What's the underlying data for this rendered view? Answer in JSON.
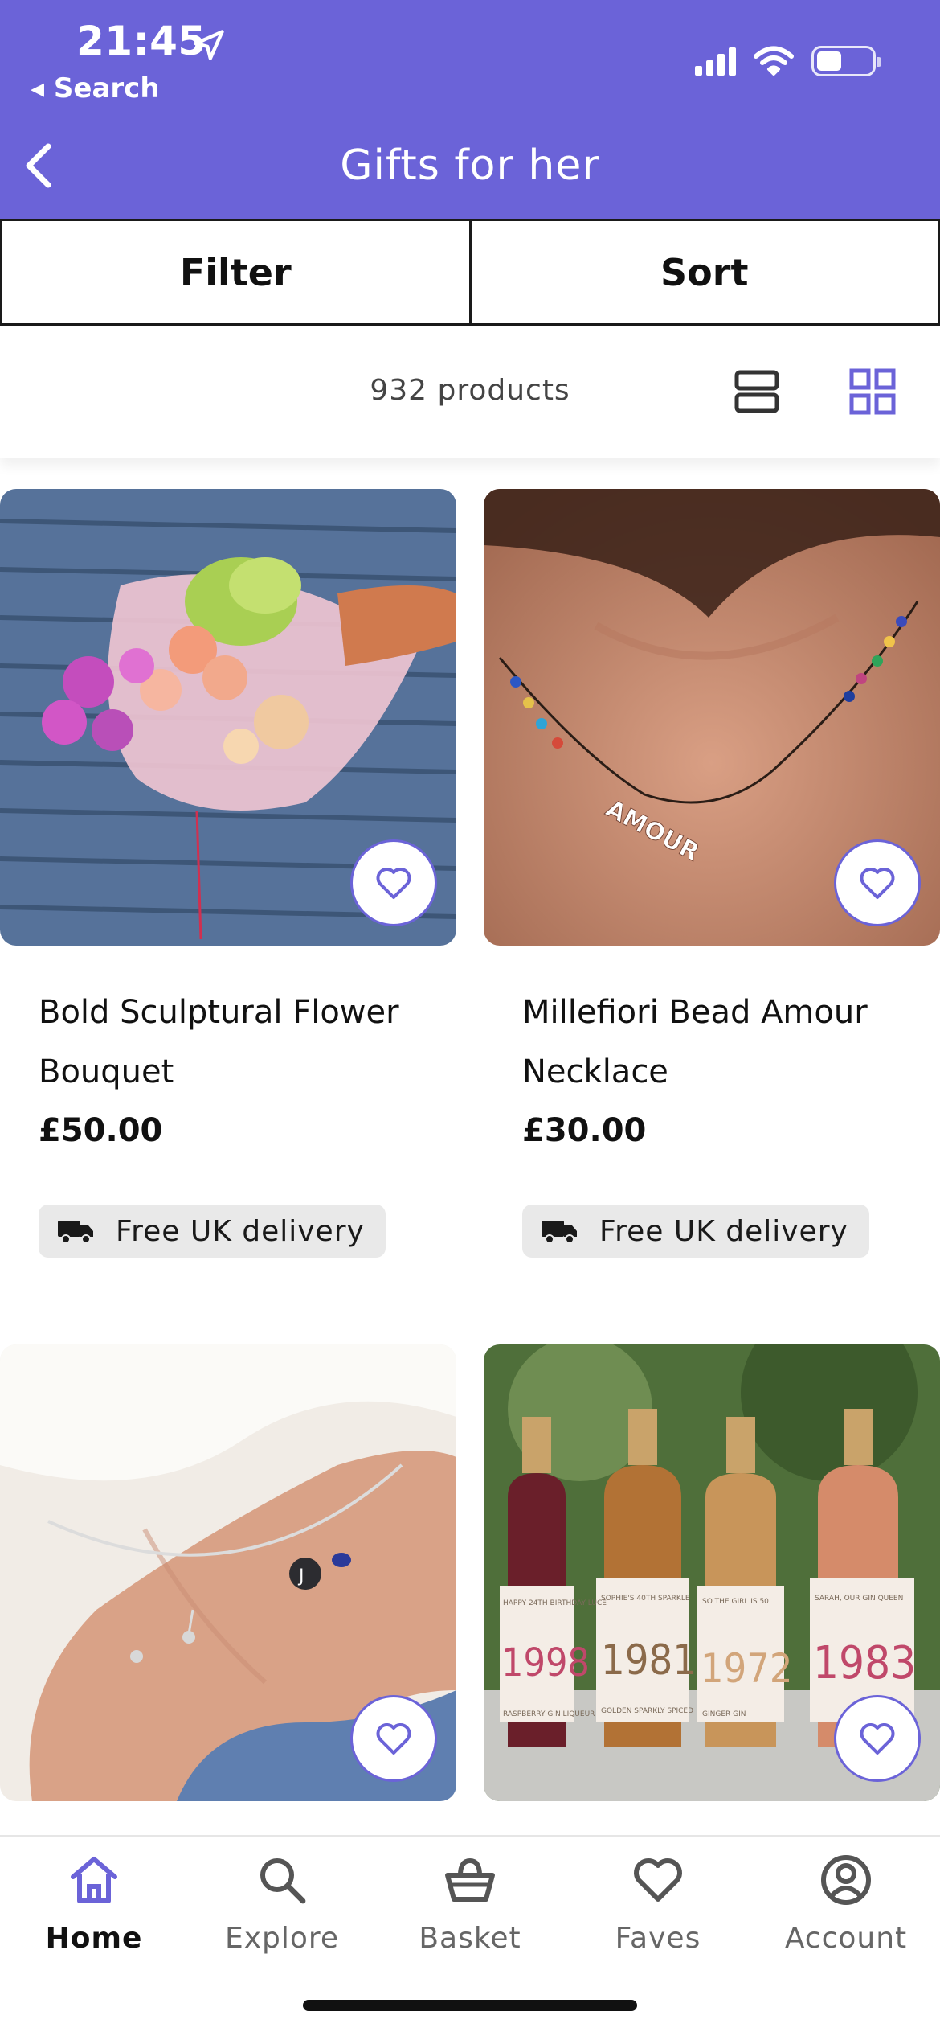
{
  "status_bar": {
    "time": "21:45",
    "back_app": "Search",
    "icons": [
      "location-arrow-icon",
      "cellular-signal-icon",
      "wifi-icon",
      "battery-icon"
    ]
  },
  "header": {
    "title": "Gifts for her",
    "back_icon": "chevron-left-icon",
    "background": "#6b63d8"
  },
  "controls": {
    "filter_label": "Filter",
    "sort_label": "Sort"
  },
  "results": {
    "count_text": "932 products",
    "view_options": [
      "list-view-icon",
      "grid-view-icon"
    ],
    "active_view": "grid"
  },
  "products": [
    {
      "name": "Bold Sculptural Flower Bouquet",
      "price": "£50.00",
      "badge": "Free UK delivery"
    },
    {
      "name": "Millefiori Bead Amour Necklace",
      "price": "£30.00",
      "badge": "Free UK delivery"
    },
    {
      "name": "",
      "price": "",
      "badge": ""
    },
    {
      "name": "",
      "price": "",
      "badge": ""
    }
  ],
  "necklace_text": "AMOUR",
  "bracelet_initial": "J",
  "gin_bottles": [
    {
      "year": "1998",
      "top": "HAPPY 24TH BIRTHDAY LUCE",
      "bottom": "RASPBERRY GIN LIQUEUR"
    },
    {
      "year": "1981",
      "top": "SOPHIE'S 40TH SPARKLE",
      "bottom": "GOLDEN SPARKLY SPICED"
    },
    {
      "year": "1972",
      "top": "SO THE GIRL IS 50",
      "bottom": "GINGER GIN"
    },
    {
      "year": "1983",
      "top": "SARAH, OUR GIN QUEEN",
      "bottom": ""
    }
  ],
  "tabbar": {
    "items": [
      {
        "label": "Home",
        "icon": "home-icon",
        "active": true
      },
      {
        "label": "Explore",
        "icon": "search-icon",
        "active": false
      },
      {
        "label": "Basket",
        "icon": "basket-icon",
        "active": false
      },
      {
        "label": "Faves",
        "icon": "heart-icon",
        "active": false
      },
      {
        "label": "Account",
        "icon": "account-icon",
        "active": false
      }
    ]
  },
  "colors": {
    "brand": "#6b63d8",
    "badge_bg": "#e9e9e9"
  }
}
